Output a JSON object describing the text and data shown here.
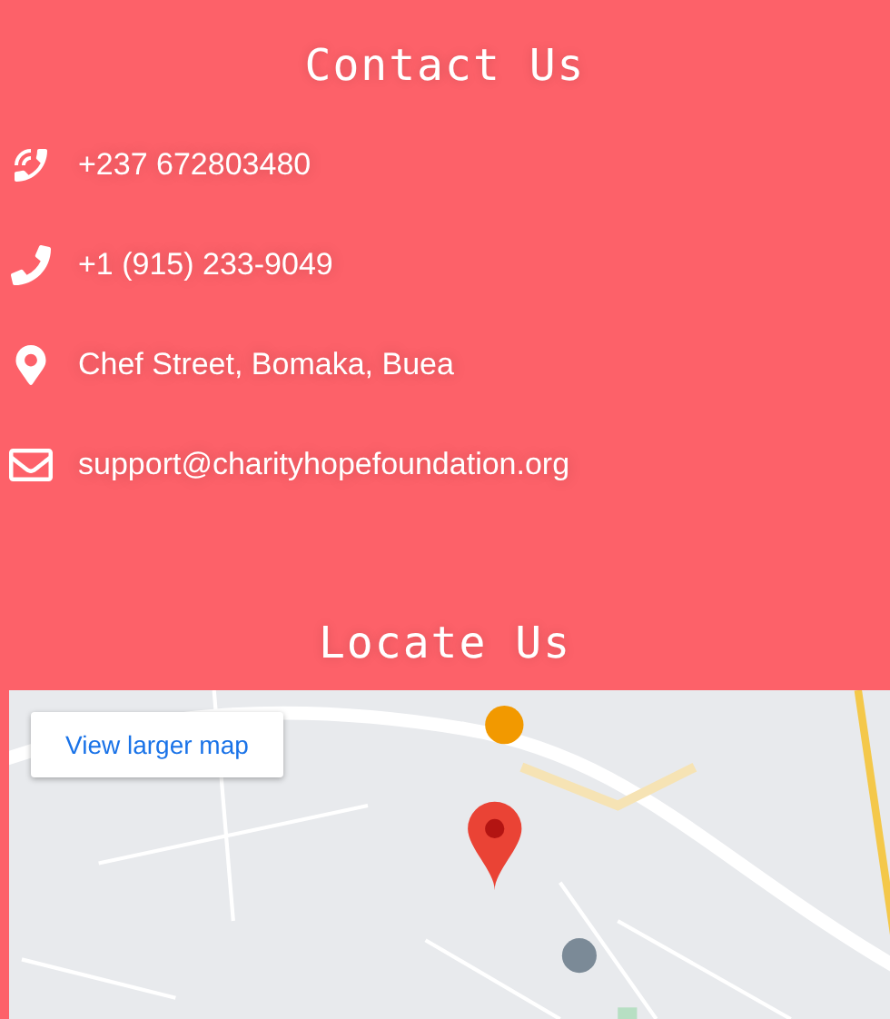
{
  "contact": {
    "title": "Contact Us",
    "items": [
      {
        "kind": "mobile",
        "text": "+237 672803480"
      },
      {
        "kind": "phone",
        "text": "+1 (915) 233-9049"
      },
      {
        "kind": "location",
        "text": "Chef Street, Bomaka, Buea"
      },
      {
        "kind": "email",
        "text": "support@charityhopefoundation.org"
      }
    ]
  },
  "locate": {
    "title": "Locate Us",
    "map": {
      "kind": "picture",
      "button": "View larger map"
    }
  }
}
